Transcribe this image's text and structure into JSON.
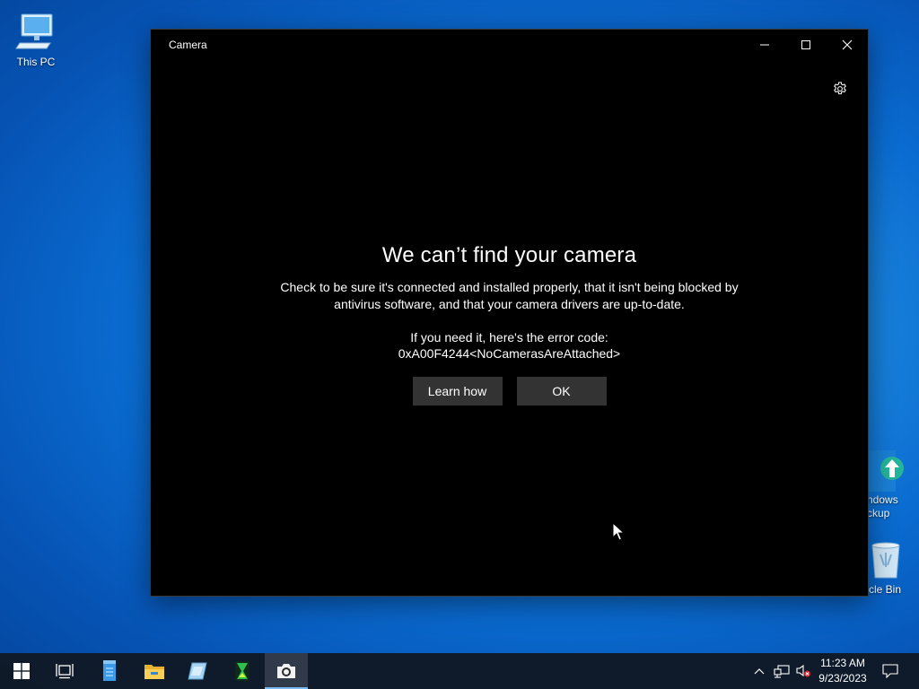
{
  "desktop": {
    "icons": [
      {
        "label": "This PC"
      },
      {
        "label": "ndows\nckup"
      },
      {
        "label": "ycle Bin"
      }
    ]
  },
  "window": {
    "title": "Camera",
    "error": {
      "heading": "We can’t find your camera",
      "body": "Check to be sure it's connected and installed properly, that it isn't being blocked by antivirus software, and that your camera drivers are up-to-date.",
      "code_label": "If you need it, here's the error code:",
      "code": "0xA00F4244<NoCamerasAreAttached>",
      "learn_label": "Learn how",
      "ok_label": "OK"
    }
  },
  "taskbar": {
    "apps": [
      "start",
      "task-view",
      "notepad",
      "file-explorer",
      "settings-app",
      "hourglass-app",
      "camera-app"
    ],
    "active_app": "camera-app",
    "clock_time": "11:23 AM",
    "clock_date": "9/23/2023"
  },
  "colors": {
    "button_bg": "#333333",
    "window_bg": "#000000",
    "taskbar_bg": "#101824"
  }
}
